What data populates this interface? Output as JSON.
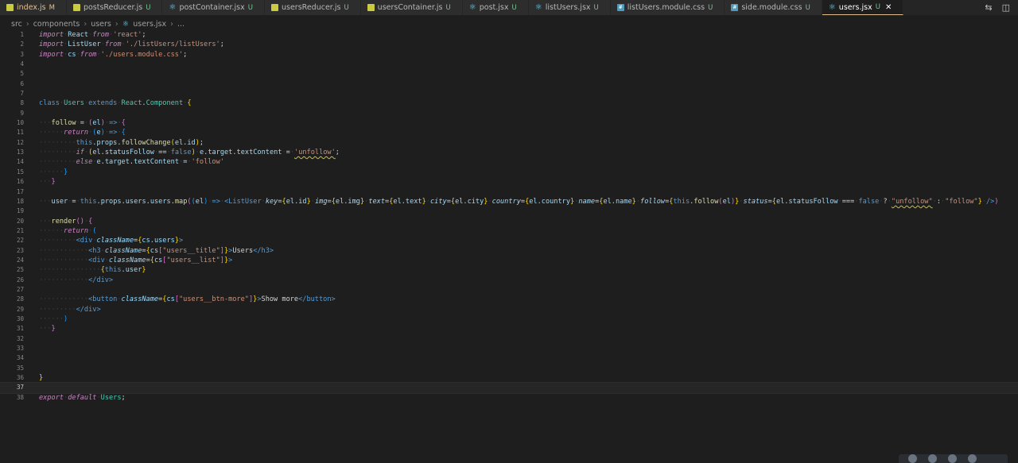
{
  "tabs": [
    {
      "label": "index.js",
      "status": "M",
      "icon": "js"
    },
    {
      "label": "postsReducer.js",
      "status": "U",
      "icon": "js"
    },
    {
      "label": "postContainer.jsx",
      "status": "U",
      "icon": "react"
    },
    {
      "label": "usersReducer.js",
      "status": "U",
      "icon": "js"
    },
    {
      "label": "usersContainer.js",
      "status": "U",
      "icon": "js"
    },
    {
      "label": "post.jsx",
      "status": "U",
      "icon": "react"
    },
    {
      "label": "listUsers.jsx",
      "status": "U",
      "icon": "react"
    },
    {
      "label": "listUsers.module.css",
      "status": "U",
      "icon": "css"
    },
    {
      "label": "side.module.css",
      "status": "U",
      "icon": "css"
    },
    {
      "label": "users.jsx",
      "status": "U",
      "icon": "react",
      "active": true
    }
  ],
  "close_glyph": "✕",
  "breadcrumb": [
    "src",
    "components",
    "users",
    "users.jsx",
    "..."
  ],
  "editor": {
    "current_line": 37,
    "lines": [
      [
        [
          "kw",
          "import"
        ],
        [
          "ws",
          "·"
        ],
        [
          "var",
          "React"
        ],
        [
          "ws",
          "·"
        ],
        [
          "kw",
          "from"
        ],
        [
          "ws",
          "·"
        ],
        [
          "str",
          "'react'"
        ],
        [
          "op",
          ";"
        ]
      ],
      [
        [
          "kw",
          "import"
        ],
        [
          "ws",
          "·"
        ],
        [
          "var",
          "ListUser"
        ],
        [
          "ws",
          "·"
        ],
        [
          "kw",
          "from"
        ],
        [
          "ws",
          "·"
        ],
        [
          "str",
          "'./listUsers/listUsers'"
        ],
        [
          "op",
          ";"
        ]
      ],
      [
        [
          "kw",
          "import"
        ],
        [
          "ws",
          "·"
        ],
        [
          "var",
          "cs"
        ],
        [
          "ws",
          "·"
        ],
        [
          "kw",
          "from"
        ],
        [
          "ws",
          "·"
        ],
        [
          "str",
          "'./users.module.css'"
        ],
        [
          "op",
          ";"
        ]
      ],
      [],
      [],
      [],
      [],
      [
        [
          "kb",
          "class"
        ],
        [
          "ws",
          "·"
        ],
        [
          "cls",
          "Users"
        ],
        [
          "ws",
          "·"
        ],
        [
          "kb",
          "extends"
        ],
        [
          "ws",
          "·"
        ],
        [
          "cls",
          "React"
        ],
        [
          "op",
          "."
        ],
        [
          "cls",
          "Component"
        ],
        [
          "ws",
          "·"
        ],
        [
          "br1",
          "{"
        ]
      ],
      [],
      [
        [
          "ws",
          "···"
        ],
        [
          "fn",
          "follow"
        ],
        [
          "ws",
          "·"
        ],
        [
          "op",
          "="
        ],
        [
          "ws",
          "·"
        ],
        [
          "br2",
          "("
        ],
        [
          "var",
          "el"
        ],
        [
          "br2",
          ")"
        ],
        [
          "ws",
          "·"
        ],
        [
          "kb",
          "=>"
        ],
        [
          "ws",
          "·"
        ],
        [
          "br2",
          "{"
        ]
      ],
      [
        [
          "ws",
          "······"
        ],
        [
          "kw",
          "return"
        ],
        [
          "ws",
          "·"
        ],
        [
          "br3",
          "("
        ],
        [
          "var",
          "e"
        ],
        [
          "br3",
          ")"
        ],
        [
          "ws",
          "·"
        ],
        [
          "kb",
          "=>"
        ],
        [
          "ws",
          "·"
        ],
        [
          "br3",
          "{"
        ]
      ],
      [
        [
          "ws",
          "·········"
        ],
        [
          "kb",
          "this"
        ],
        [
          "op",
          "."
        ],
        [
          "var",
          "props"
        ],
        [
          "op",
          "."
        ],
        [
          "fn",
          "followChange"
        ],
        [
          "br1",
          "("
        ],
        [
          "var",
          "el"
        ],
        [
          "op",
          "."
        ],
        [
          "var",
          "id"
        ],
        [
          "br1",
          ")"
        ],
        [
          "op",
          ";"
        ]
      ],
      [
        [
          "ws",
          "·········"
        ],
        [
          "kw",
          "if"
        ],
        [
          "ws",
          "·"
        ],
        [
          "br1",
          "("
        ],
        [
          "var",
          "el"
        ],
        [
          "op",
          "."
        ],
        [
          "var",
          "statusFollow"
        ],
        [
          "ws",
          "·"
        ],
        [
          "op",
          "=="
        ],
        [
          "ws",
          "·"
        ],
        [
          "kb",
          "false"
        ],
        [
          "br1",
          ")"
        ],
        [
          "ws",
          "·"
        ],
        [
          "var",
          "e"
        ],
        [
          "op",
          "."
        ],
        [
          "var",
          "target"
        ],
        [
          "op",
          "."
        ],
        [
          "var",
          "textContent"
        ],
        [
          "ws",
          "·"
        ],
        [
          "op",
          "="
        ],
        [
          "ws",
          "·"
        ],
        [
          "str",
          "'unfollow'"
        ],
        [
          "op",
          ";"
        ]
      ],
      [
        [
          "ws",
          "·········"
        ],
        [
          "kw",
          "else"
        ],
        [
          "ws",
          "·"
        ],
        [
          "var",
          "e"
        ],
        [
          "op",
          "."
        ],
        [
          "var",
          "target"
        ],
        [
          "op",
          "."
        ],
        [
          "var",
          "textContent"
        ],
        [
          "ws",
          "·"
        ],
        [
          "op",
          "="
        ],
        [
          "ws",
          "·"
        ],
        [
          "str",
          "'follow'"
        ]
      ],
      [
        [
          "ws",
          "······"
        ],
        [
          "br3",
          "}"
        ]
      ],
      [
        [
          "ws",
          "···"
        ],
        [
          "br2",
          "}"
        ]
      ],
      [],
      [
        [
          "ws",
          "···"
        ],
        [
          "var",
          "user"
        ],
        [
          "ws",
          "·"
        ],
        [
          "op",
          "="
        ],
        [
          "ws",
          "·"
        ],
        [
          "kb",
          "this"
        ],
        [
          "op",
          "."
        ],
        [
          "var",
          "props"
        ],
        [
          "op",
          "."
        ],
        [
          "var",
          "users"
        ],
        [
          "op",
          "."
        ],
        [
          "var",
          "users"
        ],
        [
          "op",
          "."
        ],
        [
          "fn",
          "map"
        ],
        [
          "br2",
          "("
        ],
        [
          "br3",
          "("
        ],
        [
          "var",
          "el"
        ],
        [
          "br3",
          ")"
        ],
        [
          "ws",
          "·"
        ],
        [
          "kb",
          "=>"
        ],
        [
          "ws",
          "·"
        ],
        [
          "tag",
          "<ListUser"
        ],
        [
          "ws",
          "·"
        ],
        [
          "attr",
          "key"
        ],
        [
          "op",
          "="
        ],
        [
          "br1",
          "{"
        ],
        [
          "var",
          "el.id"
        ],
        [
          "br1",
          "}"
        ],
        [
          "ws",
          "·"
        ],
        [
          "attr",
          "img"
        ],
        [
          "op",
          "="
        ],
        [
          "br1",
          "{"
        ],
        [
          "var",
          "el.img"
        ],
        [
          "br1",
          "}"
        ],
        [
          "ws",
          "·"
        ],
        [
          "attr",
          "text"
        ],
        [
          "op",
          "="
        ],
        [
          "br1",
          "{"
        ],
        [
          "var",
          "el.text"
        ],
        [
          "br1",
          "}"
        ],
        [
          "ws",
          "·"
        ],
        [
          "attr",
          "city"
        ],
        [
          "op",
          "="
        ],
        [
          "br1",
          "{"
        ],
        [
          "var",
          "el.city"
        ],
        [
          "br1",
          "}"
        ],
        [
          "ws",
          "·"
        ],
        [
          "attr",
          "country"
        ],
        [
          "op",
          "="
        ],
        [
          "br1",
          "{"
        ],
        [
          "var",
          "el.country"
        ],
        [
          "br1",
          "}"
        ],
        [
          "ws",
          "·"
        ],
        [
          "attr",
          "name"
        ],
        [
          "op",
          "="
        ],
        [
          "br1",
          "{"
        ],
        [
          "var",
          "el.name"
        ],
        [
          "br1",
          "}"
        ],
        [
          "ws",
          "·"
        ],
        [
          "attr",
          "follow"
        ],
        [
          "op",
          "="
        ],
        [
          "br1",
          "{"
        ],
        [
          "kb",
          "this"
        ],
        [
          "op",
          "."
        ],
        [
          "fn",
          "follow"
        ],
        [
          "br2",
          "("
        ],
        [
          "var",
          "el"
        ],
        [
          "br2",
          ")"
        ],
        [
          "br1",
          "}"
        ],
        [
          "ws",
          "·"
        ],
        [
          "attr",
          "status"
        ],
        [
          "op",
          "="
        ],
        [
          "br1",
          "{"
        ],
        [
          "var",
          "el.statusFollow"
        ],
        [
          "ws",
          "·"
        ],
        [
          "op",
          "==="
        ],
        [
          "ws",
          "·"
        ],
        [
          "kb",
          "false"
        ],
        [
          "ws",
          "·"
        ],
        [
          "op",
          "?"
        ],
        [
          "ws",
          "·"
        ],
        [
          "str",
          "\"unfollow\""
        ],
        [
          "ws",
          "·"
        ],
        [
          "op",
          ":"
        ],
        [
          "ws",
          "·"
        ],
        [
          "str",
          "\"follow\""
        ],
        [
          "br1",
          "}"
        ],
        [
          "ws",
          "·"
        ],
        [
          "tag",
          "/>"
        ],
        [
          "br2",
          ")"
        ]
      ],
      [],
      [
        [
          "ws",
          "···"
        ],
        [
          "fn",
          "render"
        ],
        [
          "br2",
          "()"
        ],
        [
          "ws",
          "·"
        ],
        [
          "br2",
          "{"
        ]
      ],
      [
        [
          "ws",
          "······"
        ],
        [
          "kw",
          "return"
        ],
        [
          "ws",
          "·"
        ],
        [
          "br3",
          "("
        ]
      ],
      [
        [
          "ws",
          "·········"
        ],
        [
          "tag",
          "<div"
        ],
        [
          "ws",
          "·"
        ],
        [
          "attr",
          "className"
        ],
        [
          "op",
          "="
        ],
        [
          "br1",
          "{"
        ],
        [
          "var",
          "cs.users"
        ],
        [
          "br1",
          "}"
        ],
        [
          "tag",
          ">"
        ]
      ],
      [
        [
          "ws",
          "············"
        ],
        [
          "tag",
          "<h3"
        ],
        [
          "ws",
          "·"
        ],
        [
          "attr",
          "className"
        ],
        [
          "op",
          "="
        ],
        [
          "br1",
          "{"
        ],
        [
          "var",
          "cs"
        ],
        [
          "br2",
          "["
        ],
        [
          "str",
          "\"users__title\""
        ],
        [
          "br2",
          "]"
        ],
        [
          "br1",
          "}"
        ],
        [
          "tag",
          ">"
        ],
        [
          "op",
          "Users"
        ],
        [
          "tag",
          "</h3>"
        ]
      ],
      [
        [
          "ws",
          "············"
        ],
        [
          "tag",
          "<div"
        ],
        [
          "ws",
          "·"
        ],
        [
          "attr",
          "className"
        ],
        [
          "op",
          "="
        ],
        [
          "br1",
          "{"
        ],
        [
          "var",
          "cs"
        ],
        [
          "br2",
          "["
        ],
        [
          "str",
          "\"users__list\""
        ],
        [
          "br2",
          "]"
        ],
        [
          "br1",
          "}"
        ],
        [
          "tag",
          ">"
        ]
      ],
      [
        [
          "ws",
          "···············"
        ],
        [
          "br1",
          "{"
        ],
        [
          "kb",
          "this"
        ],
        [
          "op",
          "."
        ],
        [
          "var",
          "user"
        ],
        [
          "br1",
          "}"
        ]
      ],
      [
        [
          "ws",
          "············"
        ],
        [
          "tag",
          "</div>"
        ]
      ],
      [],
      [
        [
          "ws",
          "············"
        ],
        [
          "tag",
          "<button"
        ],
        [
          "ws",
          "·"
        ],
        [
          "attr",
          "className"
        ],
        [
          "op",
          "="
        ],
        [
          "br1",
          "{"
        ],
        [
          "var",
          "cs"
        ],
        [
          "br2",
          "["
        ],
        [
          "str",
          "\"users__btn-more\""
        ],
        [
          "br2",
          "]"
        ],
        [
          "br1",
          "}"
        ],
        [
          "tag",
          ">"
        ],
        [
          "op",
          "Show more"
        ],
        [
          "tag",
          "</button>"
        ]
      ],
      [
        [
          "ws",
          "·········"
        ],
        [
          "tag",
          "</div>"
        ]
      ],
      [
        [
          "ws",
          "······"
        ],
        [
          "br3",
          ")"
        ]
      ],
      [
        [
          "ws",
          "···"
        ],
        [
          "br2",
          "}"
        ]
      ],
      [],
      [],
      [],
      [],
      [
        [
          "br1",
          "}"
        ]
      ],
      [],
      [
        [
          "kw",
          "export"
        ],
        [
          "ws",
          "·"
        ],
        [
          "kw",
          "default"
        ],
        [
          "ws",
          "·"
        ],
        [
          "cls",
          "Users"
        ],
        [
          "op",
          ";"
        ]
      ]
    ]
  }
}
